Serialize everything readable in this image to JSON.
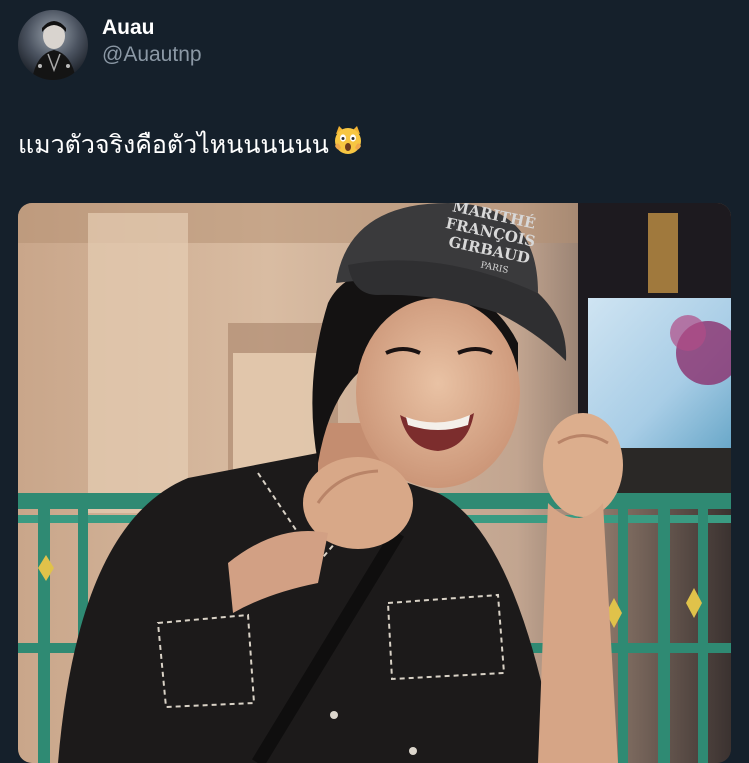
{
  "author": {
    "display_name": "Auau",
    "handle": "@Auautnp",
    "avatar_icon": "profile-photo"
  },
  "tweet": {
    "text": "แมวตัวจริงคือตัวไหนนนนนน",
    "emoji_icon": "face-screaming-cat-emoji"
  },
  "media": {
    "cap_text": [
      "MARITHÉ",
      "FRANÇOIS",
      "GIRBAUD",
      "PARIS"
    ]
  },
  "colors": {
    "background": "#15202b",
    "handle_gray": "#8b98a5",
    "railing_green": "#2f8a73"
  }
}
